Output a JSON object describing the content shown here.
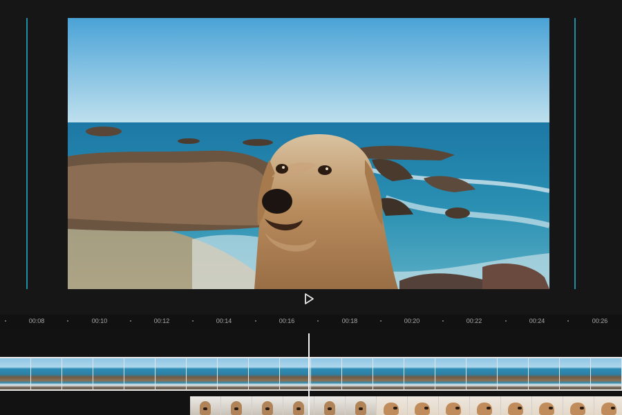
{
  "preview": {
    "scene": "dog over rocky seashore",
    "play_icon": "play-icon"
  },
  "timeline": {
    "ruler": {
      "labels": [
        "00:08",
        "00:10",
        "00:12",
        "00:14",
        "00:16",
        "00:18",
        "00:20",
        "00:22",
        "00:24",
        "00:26"
      ]
    },
    "playhead_time": "00:17"
  },
  "colors": {
    "guide": "#1f8fa8",
    "background": "#141414",
    "playhead": "#f2f2f2"
  }
}
